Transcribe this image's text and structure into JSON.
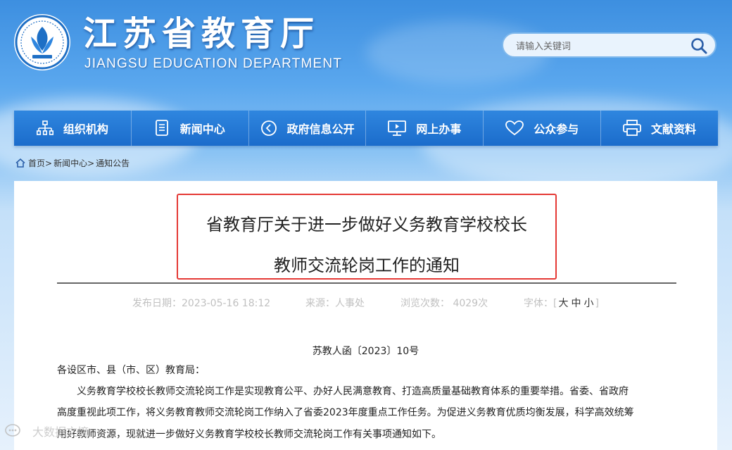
{
  "header": {
    "site_title": "江苏省教育厅",
    "site_subtitle": "JIANGSU EDUCATION DEPARTMENT",
    "logo_icon": "jiangsu-education-emblem-icon"
  },
  "search": {
    "placeholder": "请输入关键词",
    "icon": "search-icon"
  },
  "nav": {
    "items": [
      {
        "label": "组织机构",
        "icon": "org-chart-icon"
      },
      {
        "label": "新闻中心",
        "icon": "document-icon"
      },
      {
        "label": "政府信息公开",
        "icon": "play-circle-icon"
      },
      {
        "label": "网上办事",
        "icon": "monitor-icon"
      },
      {
        "label": "公众参与",
        "icon": "heart-icon"
      },
      {
        "label": "文献资料",
        "icon": "printer-icon"
      }
    ]
  },
  "breadcrumb": {
    "home_icon": "home-icon",
    "items": [
      "首页",
      "新闻中心",
      "通知公告"
    ],
    "separator": ">"
  },
  "article": {
    "title_line1": "省教育厅关于进一步做好义务教育学校校长",
    "title_line2": "教师交流轮岗工作的通知",
    "publish_date": "发布日期：2023-05-16 18:12",
    "source": "来源：人事处",
    "views": "浏览次数： 4029次",
    "font_label": "字体：",
    "font_open": "[",
    "font_large": "大",
    "font_medium": "中",
    "font_small": "小",
    "font_close": "]",
    "doc_number": "苏教人函〔2023〕10号",
    "salutation": "各设区市、县（市、区）教育局：",
    "body_line1": "义务教育学校校长教师交流轮岗工作是实现教育公平、办好人民满意教育、打造高质量基础教育体系的重要举措。省委、省政府",
    "body_line2": "高度重视此项工作，将义务教育教师交流轮岗工作纳入了省委2023年度重点工作任务。为促进义务教育优质均衡发展，科学高效统筹",
    "body_line3": "用好教师资源，现就进一步做好义务教育学校校长教师交流轮岗工作有关事项通知如下。"
  },
  "watermark": {
    "text": "大数据文摘"
  },
  "colors": {
    "nav_bg": "#2479d6",
    "highlight_border": "#e53935",
    "header_gradient_top": "#3d8fe0"
  }
}
